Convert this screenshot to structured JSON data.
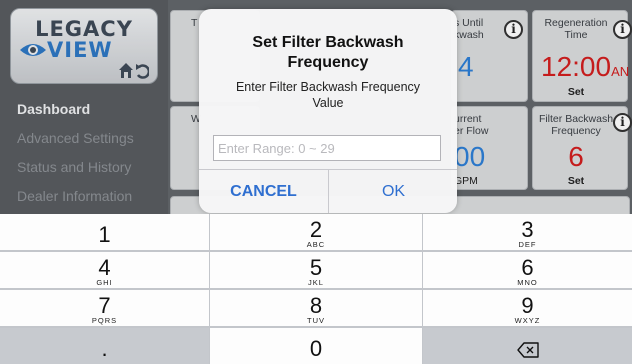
{
  "sidebar": {
    "logo": {
      "top": "LEGACY",
      "bottom": "VIEW"
    },
    "nav": [
      {
        "label": "Dashboard",
        "active": true
      },
      {
        "label": "Advanced Settings",
        "active": false
      },
      {
        "label": "Status and History",
        "active": false
      },
      {
        "label": "Dealer Information",
        "active": false
      }
    ]
  },
  "tiles": {
    "t1": {
      "title": "T"
    },
    "t2": {
      "title": "s Until\nkwash",
      "value": "4"
    },
    "t3": {
      "title": "Regeneration\nTime",
      "value": "12:00",
      "value_suffix": "AN",
      "set": "Set"
    },
    "t4": {
      "title": "W"
    },
    "t5": {
      "title": "urrent\ner Flow",
      "value": "00",
      "unit": "GPM"
    },
    "t6": {
      "title": "Filter Backwash\nFrequency",
      "value": "6",
      "set": "Set"
    },
    "info_icon": "i"
  },
  "dialog": {
    "title": "Set Filter Backwash\nFrequency",
    "message": "Enter Filter Backwash Frequency\nValue",
    "input_placeholder": "Enter Range: 0 ~ 29",
    "input_value": "",
    "cancel_label": "CANCEL",
    "ok_label": "OK"
  },
  "keypad": {
    "keys": [
      {
        "num": "1",
        "sub": ""
      },
      {
        "num": "2",
        "sub": "ABC"
      },
      {
        "num": "3",
        "sub": "DEF"
      },
      {
        "num": "4",
        "sub": "GHI"
      },
      {
        "num": "5",
        "sub": "JKL"
      },
      {
        "num": "6",
        "sub": "MNO"
      },
      {
        "num": "7",
        "sub": "PQRS"
      },
      {
        "num": "8",
        "sub": "TUV"
      },
      {
        "num": "9",
        "sub": "WXYZ"
      },
      {
        "num": ".",
        "sub": ""
      },
      {
        "num": "0",
        "sub": ""
      }
    ],
    "delete_icon": "backspace-icon"
  },
  "colors": {
    "sidebar_bg": "#595c60",
    "accent_blue": "#2f6fd0",
    "value_red": "#d21e1e",
    "value_blue": "#2d7fd6",
    "keypad_bg": "#c3c6cb"
  }
}
